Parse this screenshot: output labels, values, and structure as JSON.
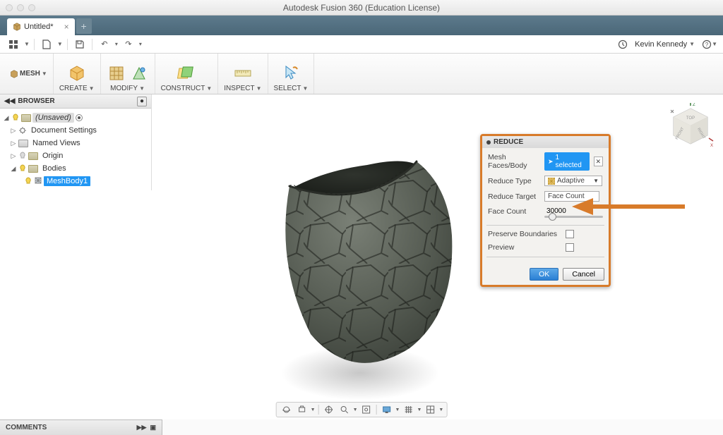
{
  "titlebar": {
    "title": "Autodesk Fusion 360 (Education License)"
  },
  "tab": {
    "label": "Untitled*"
  },
  "qat": {
    "user": "Kevin Kennedy"
  },
  "ribbon": {
    "workspace": "MESH",
    "groups": {
      "create": "CREATE",
      "modify": "MODIFY",
      "construct": "CONSTRUCT",
      "inspect": "INSPECT",
      "select": "SELECT"
    }
  },
  "browser": {
    "title": "BROWSER",
    "root": "(Unsaved)",
    "items": {
      "doc_settings": "Document Settings",
      "named_views": "Named Views",
      "origin": "Origin",
      "bodies": "Bodies",
      "meshbody": "MeshBody1"
    }
  },
  "dialog": {
    "title": "REDUCE",
    "mesh_faces_label": "Mesh Faces/Body",
    "selected_chip": "1 selected",
    "reduce_type_label": "Reduce Type",
    "reduce_type_value": "Adaptive",
    "reduce_target_label": "Reduce Target",
    "reduce_target_value": "Face Count",
    "face_count_label": "Face Count",
    "face_count_value": "30000",
    "preserve_label": "Preserve Boundaries",
    "preview_label": "Preview",
    "ok": "OK",
    "cancel": "Cancel"
  },
  "comments": {
    "title": "COMMENTS"
  },
  "viewcube": {
    "top": "TOP",
    "front": "FRONT",
    "right": "RIGHT"
  }
}
